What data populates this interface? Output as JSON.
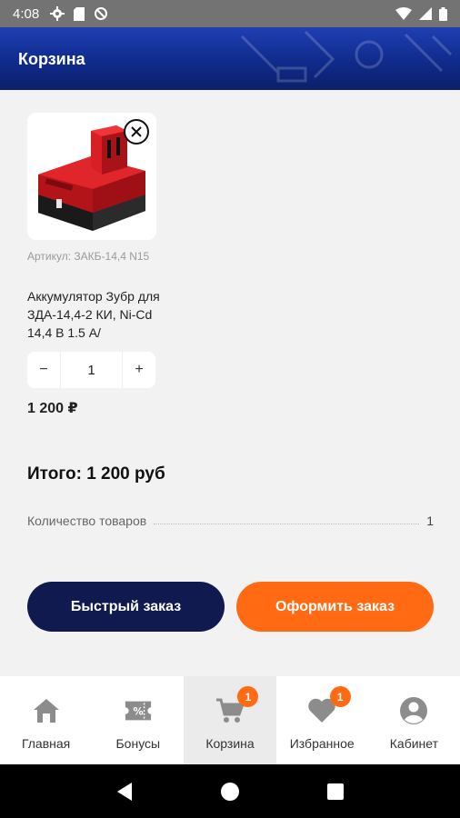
{
  "status_bar": {
    "time": "4:08"
  },
  "header": {
    "title": "Корзина"
  },
  "cart_item": {
    "sku": "Артикул: ЗАКБ-14,4 N15",
    "name": "Аккумулятор Зубр для ЗДА-14,4-2  КИ, Ni-Cd 14,4 В 1.5 А/",
    "quantity": "1",
    "minus_label": "−",
    "plus_label": "+",
    "price": "1 200 ₽",
    "remove_icon": "close-icon"
  },
  "summary": {
    "total": "Итого: 1 200 руб",
    "count_label": "Количество товаров",
    "count_value": "1"
  },
  "actions": {
    "quick_order": "Быстрый заказ",
    "checkout": "Оформить заказ"
  },
  "bottom_nav": {
    "items": [
      {
        "label": "Главная",
        "icon": "home-icon"
      },
      {
        "label": "Бонусы",
        "icon": "ticket-icon"
      },
      {
        "label": "Корзина",
        "icon": "cart-icon",
        "badge": "1",
        "active": true
      },
      {
        "label": "Избранное",
        "icon": "heart-icon",
        "badge": "1"
      },
      {
        "label": "Кабинет",
        "icon": "user-icon"
      }
    ]
  },
  "colors": {
    "accent_orange": "#ff6a13",
    "dark_navy": "#101a4f",
    "header_blue": "#102b8c"
  }
}
